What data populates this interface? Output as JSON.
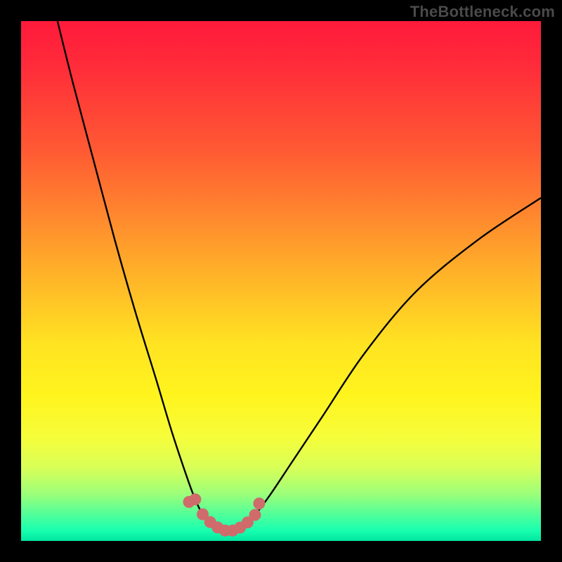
{
  "watermark": "TheBottleneck.com",
  "chart_data": {
    "type": "line",
    "title": "",
    "xlabel": "",
    "ylabel": "",
    "xlim": [
      0,
      100
    ],
    "ylim": [
      0,
      100
    ],
    "series": [
      {
        "name": "curve",
        "x": [
          7,
          10,
          14,
          18,
          22,
          26,
          29,
          32,
          33.5,
          35,
          37,
          39,
          41,
          43,
          45,
          48,
          52,
          58,
          66,
          76,
          88,
          100
        ],
        "values": [
          100,
          88,
          73,
          58,
          44,
          31,
          21,
          12,
          8,
          5,
          3,
          2,
          2,
          3,
          5,
          9,
          15,
          24,
          36,
          48,
          58,
          66
        ]
      }
    ],
    "flat_zone": {
      "x_start": 33.5,
      "x_end": 45,
      "y": 3
    },
    "marker_color": "#cf6b6b",
    "curve_color": "#000000",
    "gradient_stops": [
      {
        "pos": 0,
        "color": "#ff1a3b"
      },
      {
        "pos": 25,
        "color": "#ff5a33"
      },
      {
        "pos": 50,
        "color": "#ffb728"
      },
      {
        "pos": 72,
        "color": "#fff41e"
      },
      {
        "pos": 91,
        "color": "#9cff7a"
      },
      {
        "pos": 100,
        "color": "#00e6a0"
      }
    ]
  }
}
